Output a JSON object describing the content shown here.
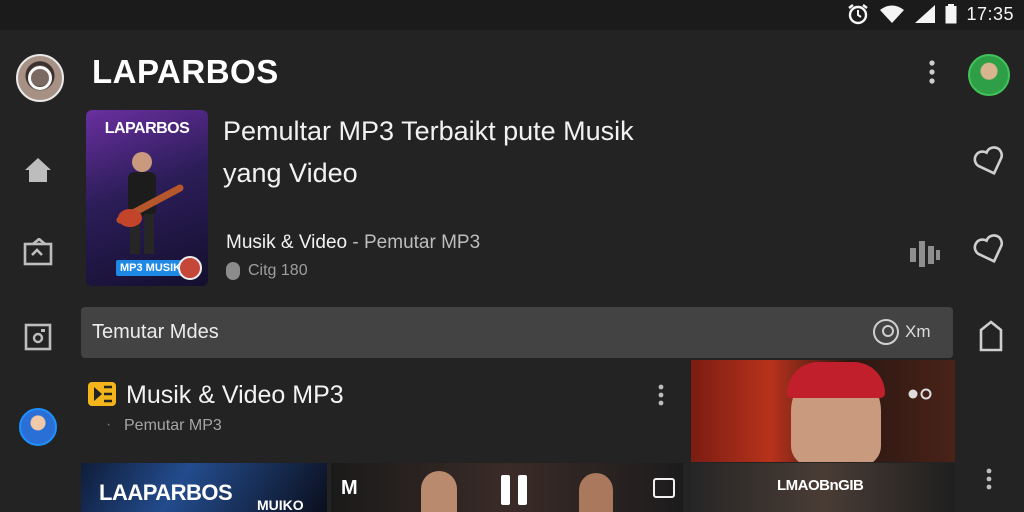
{
  "status_bar": {
    "time": "17:35",
    "icons": [
      "alarm-icon",
      "wifi-icon",
      "signal-icon",
      "battery-icon"
    ]
  },
  "header": {
    "title": "LAPARBOS"
  },
  "rail": {
    "items": [
      "home-icon",
      "library-icon",
      "camera-icon"
    ]
  },
  "featured": {
    "thumbnail_brand": "LAPARBOS",
    "thumbnail_tag": "MP3 MUSIK",
    "title_line1": "Pemultar MP3 Terbaikt pute Musik",
    "title_line2": "yang Video",
    "subtitle_main": "Musik & Video",
    "subtitle_sep": " - ",
    "subtitle_dim": "Pemutar MP3",
    "meta": "Citg 180"
  },
  "search": {
    "text": "Temutar Mdes",
    "account_label": "Xm"
  },
  "list_item": {
    "title": "Musik  & Video MP3",
    "subtitle": "Pemutar MP3"
  },
  "bottom": {
    "thumb1_title": "LAAPARBOS",
    "thumb1_sub": "MUIKO",
    "thumb2_label": "M",
    "thumb3_title": "LMAOBnGIB"
  },
  "colors": {
    "background": "#232323",
    "status_bar": "#1b1b1b",
    "search_bar": "#434343",
    "accent_blue": "#1e88e5",
    "accent_yellow": "#f3b51b"
  }
}
